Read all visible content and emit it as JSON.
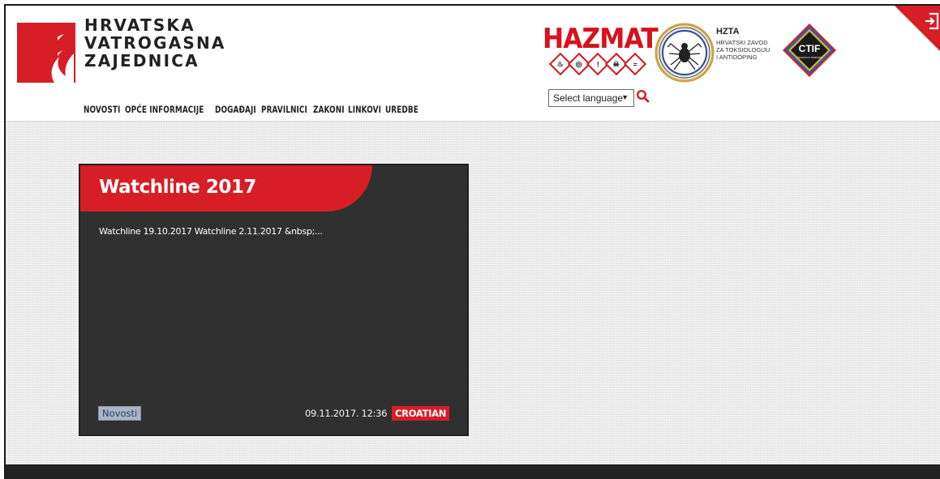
{
  "brand": {
    "line1": "HRVATSKA",
    "line2": "VATROGASNA",
    "line3": "ZAJEDNICA",
    "accent": "#d71d25"
  },
  "nav": {
    "items": [
      "NOVOSTI",
      "OPĆE INFORMACIJE",
      "DOGAĐAJI",
      "PRAVILNICI",
      "ZAKONI",
      "LINKOVI",
      "UREDBE"
    ]
  },
  "partners": {
    "hazmat": "HAZMAT",
    "hzta_title": "HZTA",
    "hzta_line1": "HRVATSKI ZAVOD",
    "hzta_line2": "ZA TOKSIOLOGIJU",
    "hzta_line3": "I ANTIDOPING",
    "ctif": "CTIF"
  },
  "language_select": {
    "value": "Select language"
  },
  "icons": {
    "search": "search-icon",
    "corner": "logout-icon"
  },
  "card": {
    "title": "Watchline 2017",
    "excerpt": "Watchline 19.10.2017 Watchline 2.11.2017 &nbsp;...",
    "category": "Novosti",
    "date": "09.11.2017. 12:36",
    "language": "CROATIAN"
  }
}
